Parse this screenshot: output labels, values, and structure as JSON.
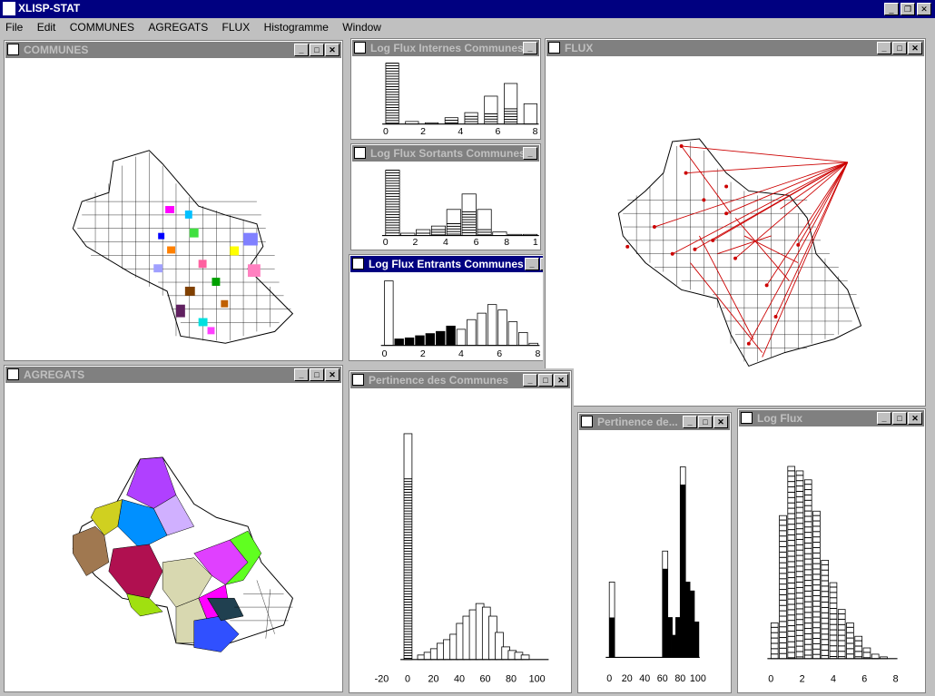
{
  "app": {
    "title": "XLISP-STAT"
  },
  "menu": [
    "File",
    "Edit",
    "COMMUNES",
    "AGREGATS",
    "FLUX",
    "Histogramme",
    "Window"
  ],
  "windows": {
    "communes": {
      "title": "COMMUNES"
    },
    "agregats": {
      "title": "AGREGATS"
    },
    "flux": {
      "title": "FLUX"
    },
    "log_internes": {
      "title": "Log Flux Internes Communes",
      "ticks": [
        "0",
        "2",
        "4",
        "6",
        "8"
      ]
    },
    "log_sortants": {
      "title": "Log Flux Sortants Communes",
      "ticks": [
        "0",
        "2",
        "4",
        "6",
        "8",
        "1"
      ]
    },
    "log_entrants": {
      "title": "Log Flux Entrants Communes",
      "ticks": [
        "0",
        "2",
        "4",
        "6",
        "8"
      ]
    },
    "pertinence_communes": {
      "title": "Pertinence des Communes",
      "ticks": [
        "-20",
        "0",
        "20",
        "40",
        "60",
        "80",
        "100"
      ]
    },
    "pertinence_de": {
      "title": "Pertinence de...",
      "ticks": [
        "0",
        "20",
        "40",
        "60",
        "80",
        "100"
      ]
    },
    "log_flux": {
      "title": "Log Flux",
      "ticks": [
        "0",
        "2",
        "4",
        "6",
        "8"
      ]
    }
  },
  "chart_data": [
    {
      "type": "bar",
      "name_ref": "log_internes",
      "x": [
        0,
        1,
        2,
        3,
        4,
        5,
        6,
        7
      ],
      "values": [
        48,
        2,
        1,
        5,
        9,
        22,
        32,
        16
      ],
      "selected": [
        48,
        0,
        0,
        3,
        6,
        8,
        12,
        0
      ]
    },
    {
      "type": "bar",
      "name_ref": "log_sortants",
      "x": [
        0,
        1,
        2,
        3,
        4,
        5,
        6,
        7,
        8,
        9
      ],
      "values": [
        55,
        2,
        5,
        8,
        22,
        35,
        22,
        3,
        1,
        1
      ],
      "selected": [
        55,
        0,
        2,
        5,
        10,
        20,
        5,
        0,
        0,
        0
      ]
    },
    {
      "type": "bar",
      "name_ref": "log_entrants",
      "x": [
        0,
        0.5,
        1,
        1.5,
        2,
        2.5,
        3,
        3.5,
        4,
        4.5,
        5,
        5.5,
        6,
        6.5,
        7
      ],
      "values": [
        60,
        6,
        7,
        9,
        11,
        13,
        18,
        15,
        24,
        30,
        38,
        33,
        22,
        12,
        2
      ],
      "selected": [
        0,
        6,
        7,
        9,
        11,
        13,
        18,
        0,
        0,
        0,
        0,
        0,
        0,
        0,
        0
      ]
    },
    {
      "type": "bar",
      "name_ref": "pertinence_communes",
      "x": [
        0,
        5,
        10,
        15,
        20,
        25,
        30,
        35,
        40,
        45,
        50,
        55,
        60,
        65,
        70,
        75,
        80,
        85
      ],
      "values": [
        250,
        5,
        8,
        12,
        18,
        22,
        28,
        40,
        48,
        55,
        62,
        58,
        48,
        30,
        14,
        10,
        8,
        5
      ],
      "selected": [
        200,
        0,
        0,
        0,
        0,
        0,
        0,
        0,
        0,
        0,
        0,
        0,
        0,
        0,
        0,
        0,
        0,
        0
      ]
    },
    {
      "type": "bar",
      "name_ref": "pertinence_de",
      "x": [
        0,
        60,
        65,
        70,
        75,
        80,
        85,
        90,
        95
      ],
      "values": [
        85,
        120,
        45,
        25,
        45,
        215,
        85,
        75,
        40
      ],
      "selected": [
        45,
        100,
        45,
        25,
        45,
        195,
        85,
        75,
        40
      ]
    },
    {
      "type": "bar",
      "name_ref": "log_flux",
      "x": [
        0,
        0.5,
        1,
        1.5,
        2,
        2.5,
        3,
        3.5,
        4,
        4.5,
        5,
        5.5,
        6,
        6.5,
        7
      ],
      "values": [
        40,
        160,
        215,
        210,
        200,
        165,
        110,
        85,
        55,
        40,
        25,
        12,
        5,
        2,
        0
      ]
    }
  ],
  "colors": {
    "title_active": "#000080",
    "title_inactive": "#808080",
    "chrome": "#c0c0c0",
    "flow_line": "#cc0000"
  }
}
